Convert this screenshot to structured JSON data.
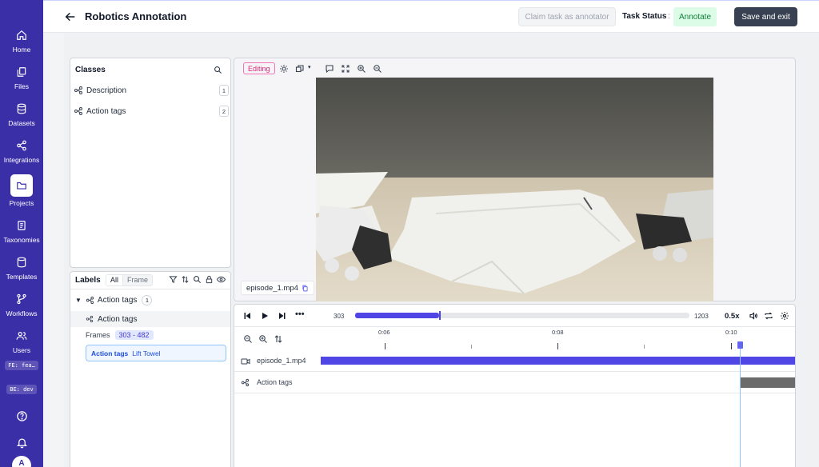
{
  "app": {
    "title": "Robotics Annotation",
    "claim_button": "Claim task as annotator",
    "task_status_label": "Task Status",
    "task_status_sep": ":",
    "task_status_value": "Annotate",
    "save_exit_button": "Save and exit"
  },
  "sidebar": {
    "items": [
      {
        "label": "Home",
        "icon": "home-icon"
      },
      {
        "label": "Files",
        "icon": "files-icon"
      },
      {
        "label": "Datasets",
        "icon": "datasets-icon"
      },
      {
        "label": "Integrations",
        "icon": "integrations-icon"
      },
      {
        "label": "Projects",
        "icon": "folder-icon",
        "active": true
      },
      {
        "label": "Taxonomies",
        "icon": "taxonomies-icon"
      },
      {
        "label": "Templates",
        "icon": "templates-icon"
      },
      {
        "label": "Workflows",
        "icon": "workflows-icon"
      },
      {
        "label": "Users",
        "icon": "users-icon"
      }
    ],
    "fe_badge": "FE: fea…",
    "be_badge": "BE: dev",
    "avatar_initial": "A"
  },
  "classes": {
    "title": "Classes",
    "items": [
      {
        "name": "Description",
        "key": "1"
      },
      {
        "name": "Action tags",
        "key": "2"
      }
    ]
  },
  "labels": {
    "title": "Labels",
    "filter_all": "All",
    "filter_frame": "Frame",
    "group_name": "Action tags",
    "group_count": "1",
    "item_name": "Action tags",
    "frames_label": "Frames",
    "frames_range": "303 - 482",
    "chip_class": "Action tags",
    "chip_value": "Lift Towel"
  },
  "viewer": {
    "mode_badge": "Editing",
    "file_name": "episode_1.mp4"
  },
  "timeline": {
    "current_frame": "303",
    "total_frames": "1203",
    "progress_fraction": 0.252,
    "speed": "0.5x",
    "ruler_labels": [
      "0:06",
      "0:08",
      "0:10"
    ],
    "tracks": [
      {
        "name": "episode_1.mp4",
        "icon": "video-icon"
      },
      {
        "name": "Action tags",
        "icon": "class-icon"
      }
    ],
    "colors": {
      "accent": "#4f46e5",
      "tag_segment": "#6b6b6b"
    }
  }
}
